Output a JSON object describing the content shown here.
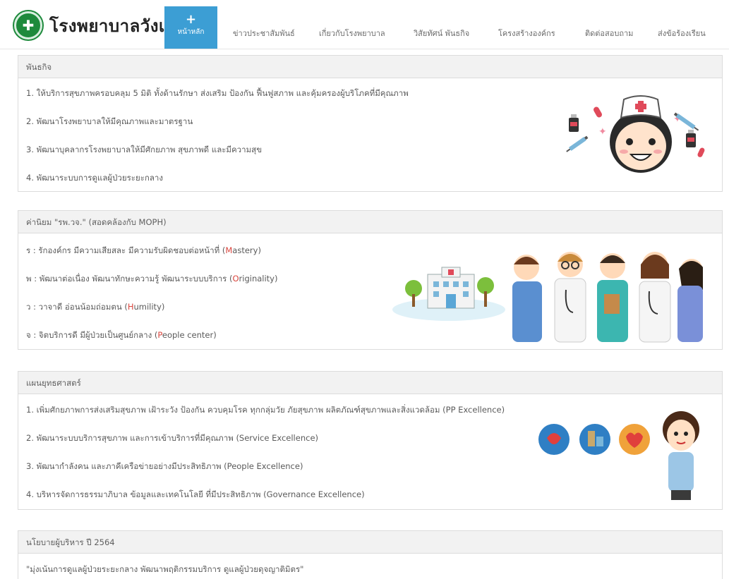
{
  "brand": {
    "name": "โรงพยาบาลวังเจ้า"
  },
  "nav": {
    "home_icon": "plus-icon",
    "home_label": "หน้าหลัก",
    "items": [
      "ข่าวประชาสัมพันธ์",
      "เกี่ยวกับโรงพยาบาล",
      "วิสัยทัศน์ พันธกิจ",
      "โครงสร้างองค์กร",
      "ติดต่อสอบถาม",
      "ส่งข้อร้องเรียน"
    ]
  },
  "mission": {
    "title": "พันธกิจ",
    "items": [
      "1. ให้บริการสุขภาพครอบคลุม 5 มิติ ทั้งด้านรักษา ส่งเสริม ป้องกัน ฟื้นฟูสภาพ และคุ้มครองผู้บริโภคที่มีคุณภาพ",
      "2. พัฒนาโรงพยาบาลให้มีคุณภาพและมาตรฐาน",
      "3. พัฒนาบุคลากรโรงพยาบาลให้มีศักยภาพ สุขภาพดี และมีความสุข",
      "4. พัฒนาระบบการดูแลผู้ป่วยระยะกลาง"
    ]
  },
  "values": {
    "title": "ค่านิยม \"รพ.วจ.\" (สอดคล้องกับ MOPH)",
    "items": [
      {
        "text": "ร : รักองค์กร มีความเสียสละ มีความรับผิดชอบต่อหน้าที่ (",
        "letter": "M",
        "rest": "astery)"
      },
      {
        "text": "พ : พัฒนาต่อเนื่อง พัฒนาทักษะความรู้ พัฒนาระบบบริการ (",
        "letter": "O",
        "rest": "riginality)"
      },
      {
        "text": "ว : วาจาดี อ่อนน้อมถ่อมตน (",
        "letter": "H",
        "rest": "umility)"
      },
      {
        "text": "จ : จิตบริการดี มีผู้ป่วยเป็นศูนย์กลาง (",
        "letter": "P",
        "rest": "eople center)"
      }
    ]
  },
  "strategy": {
    "title": "แผนยุทธศาสตร์",
    "items": [
      "1. เพิ่มศักยภาพการส่งเสริมสุขภาพ เฝ้าระวัง ป้องกัน ควบคุมโรค ทุกกลุ่มวัย ภัยสุขภาพ ผลิตภัณฑ์สุขภาพและสิ่งแวดล้อม (PP Excellence)",
      "2. พัฒนาระบบบริการสุขภาพ และการเข้าบริการที่มีคุณภาพ (Service Excellence)",
      "3. พัฒนากำลังคน และภาคีเครือข่ายอย่างมีประสิทธิภาพ (People Excellence)",
      "4. บริหารจัดการธรรมาภิบาล ข้อมูลและเทคโนโลยี ที่มีประสิทธิภาพ (Governance Excellence)"
    ]
  },
  "policy": {
    "title": "นโยบายผู้บริหาร ปี 2564",
    "items": [
      "\"มุ่งเน้นการดูแลผู้ป่วยระยะกลาง พัฒนาพฤติกรรมบริการ ดูแลผู้ป่วยดุจญาติมิตร\""
    ]
  },
  "colors": {
    "nav_active": "#3c9ed4",
    "accent_letter": "#d9453d",
    "panel_head": "#f2f2f2",
    "logo_green": "#1e8a3c"
  }
}
